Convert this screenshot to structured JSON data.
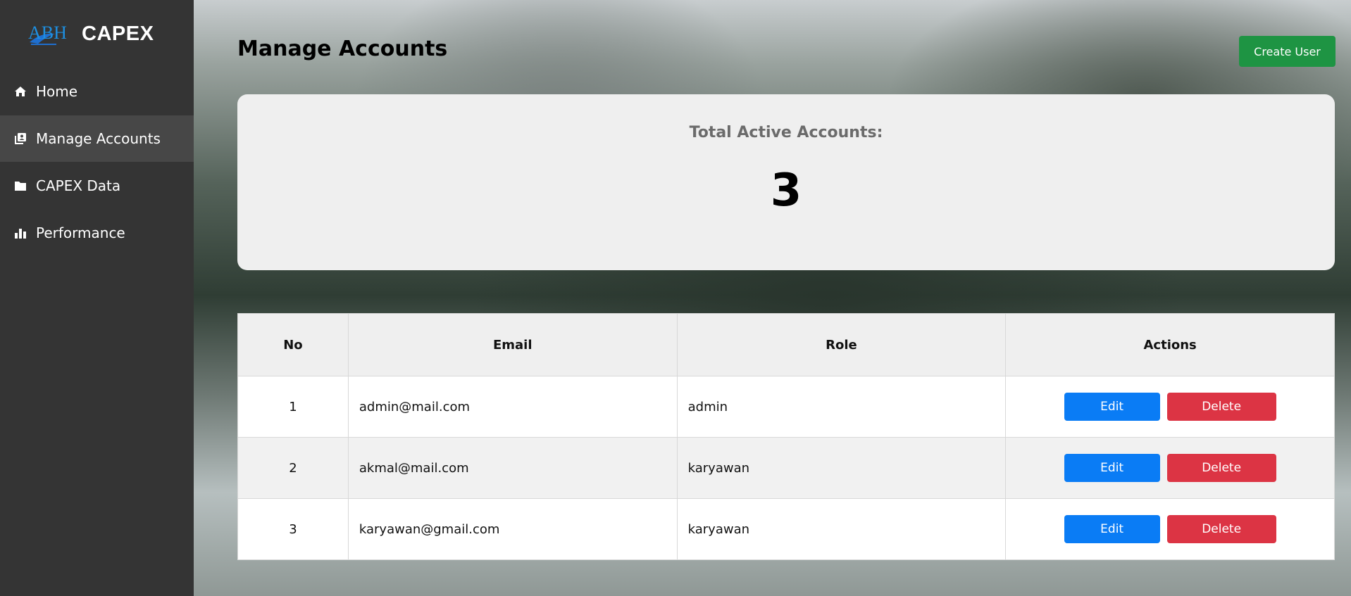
{
  "app": {
    "brand": "CAPEX",
    "logo_text": "ABH"
  },
  "sidebar": {
    "items": [
      {
        "label": "Home",
        "icon": "home-icon",
        "active": false
      },
      {
        "label": "Manage Accounts",
        "icon": "accounts-icon",
        "active": true
      },
      {
        "label": "CAPEX Data",
        "icon": "folder-icon",
        "active": false
      },
      {
        "label": "Performance",
        "icon": "bar-chart-icon",
        "active": false
      }
    ]
  },
  "header": {
    "title": "Manage Accounts",
    "create_label": "Create User"
  },
  "summary": {
    "label": "Total Active Accounts:",
    "value": "3"
  },
  "table": {
    "headers": [
      "No",
      "Email",
      "Role",
      "Actions"
    ],
    "rows": [
      {
        "no": "1",
        "email": "admin@mail.com",
        "role": "admin"
      },
      {
        "no": "2",
        "email": "akmal@mail.com",
        "role": "karyawan"
      },
      {
        "no": "3",
        "email": "karyawan@gmail.com",
        "role": "karyawan"
      }
    ],
    "edit_label": "Edit",
    "delete_label": "Delete"
  },
  "colors": {
    "sidebar": "#343434",
    "sidebar_active": "#474747",
    "create": "#1e9443",
    "edit": "#0a7cf5",
    "delete": "#dc3444"
  }
}
